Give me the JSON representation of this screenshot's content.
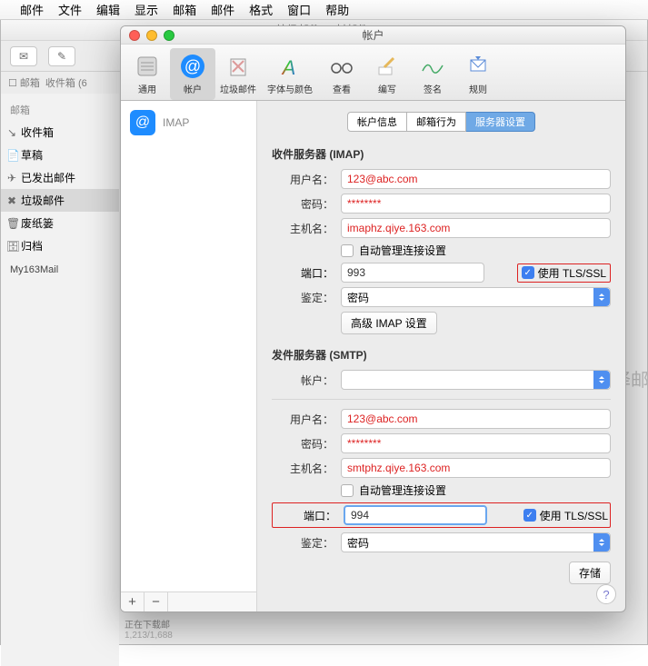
{
  "menubar": {
    "items": [
      "邮件",
      "文件",
      "编辑",
      "显示",
      "邮箱",
      "邮件",
      "格式",
      "窗口",
      "帮助"
    ]
  },
  "mainwin": {
    "title": "垃圾邮件 (0 封邮件)",
    "breadcrumb": {
      "mailbox_icon_label": "邮箱",
      "inbox_text": "收件箱 (6"
    },
    "sidebar": {
      "header": "邮箱",
      "items": [
        {
          "icon": "✉",
          "label": "收件箱"
        },
        {
          "icon": "📄",
          "label": "草稿"
        },
        {
          "icon": "✈",
          "label": "已发出邮件"
        },
        {
          "icon": "🗑",
          "label": "垃圾邮件",
          "selected": true
        },
        {
          "icon": "🗑",
          "label": "废纸篓"
        },
        {
          "icon": "🗄",
          "label": "归档"
        }
      ],
      "account": "My163Mail"
    },
    "status": {
      "text": "正在下载邮",
      "counts": "1,213/1,688"
    }
  },
  "pref": {
    "title": "帐户",
    "toolbar": [
      {
        "label": "通用"
      },
      {
        "label": "帐户",
        "selected": true
      },
      {
        "label": "垃圾邮件"
      },
      {
        "label": "字体与颜色"
      },
      {
        "label": "查看"
      },
      {
        "label": "编写"
      },
      {
        "label": "签名"
      },
      {
        "label": "规则"
      }
    ],
    "account_list": {
      "item_label": "IMAP",
      "add": "+",
      "remove": "−"
    },
    "tabs": {
      "a": "帐户信息",
      "b": "邮箱行为",
      "c": "服务器设置"
    },
    "imap": {
      "section": "收件服务器 (IMAP)",
      "user_label": "用户名：",
      "user": "123@abc.com",
      "pass_label": "密码：",
      "pass": "********",
      "host_label": "主机名：",
      "host": "imaphz.qiye.163.com",
      "auto": "自动管理连接设置",
      "port_label": "端口：",
      "port": "993",
      "tls_label": "使用 TLS/SSL",
      "auth_label": "鉴定：",
      "auth": "密码",
      "adv_btn": "高级 IMAP 设置"
    },
    "smtp": {
      "section": "发件服务器 (SMTP)",
      "acct_label": "帐户：",
      "acct": "",
      "user_label": "用户名：",
      "user": "123@abc.com",
      "pass_label": "密码：",
      "pass": "********",
      "host_label": "主机名：",
      "host": "smtphz.qiye.163.com",
      "auto": "自动管理连接设置",
      "port_label": "端口：",
      "port": "994",
      "tls_label": "使用 TLS/SSL",
      "auth_label": "鉴定：",
      "auth": "密码"
    },
    "save": "存储",
    "help": "?"
  },
  "side_hint": "译邮"
}
